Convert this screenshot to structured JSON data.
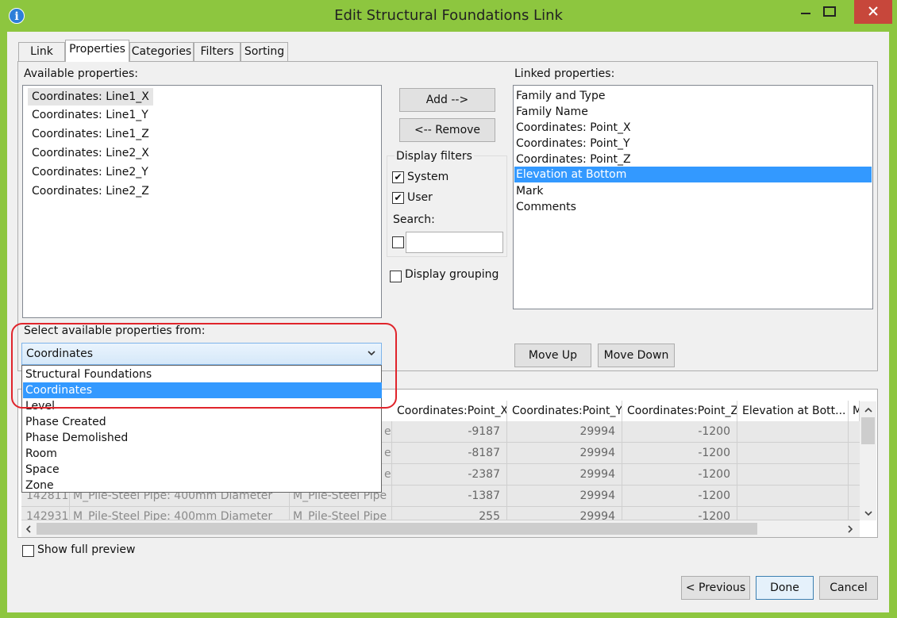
{
  "window": {
    "title": "Edit Structural Foundations Link",
    "app_icon": "info-icon",
    "minimize_icon": "minimize-icon",
    "maximize_icon": "maximize-icon",
    "close_icon": "close-icon",
    "title_bar_color": "#8dc63f",
    "close_color": "#c7473b"
  },
  "tabs": [
    {
      "label": "Link",
      "active": false
    },
    {
      "label": "Properties",
      "active": true
    },
    {
      "label": "Categories",
      "active": false
    },
    {
      "label": "Filters",
      "active": false
    },
    {
      "label": "Sorting",
      "active": false
    }
  ],
  "available": {
    "label": "Available properties:",
    "items": [
      "Coordinates: Line1_X",
      "Coordinates: Line1_Y",
      "Coordinates: Line1_Z",
      "Coordinates: Line2_X",
      "Coordinates: Line2_Y",
      "Coordinates: Line2_Z"
    ],
    "selected": "Coordinates: Line1_X"
  },
  "buttons": {
    "add": "Add -->",
    "remove": "<-- Remove",
    "move_up": "Move Up",
    "move_down": "Move Down",
    "previous": "< Previous",
    "done": "Done",
    "cancel": "Cancel"
  },
  "display_filters": {
    "label": "Display filters",
    "system": {
      "label": "System",
      "checked": true
    },
    "user": {
      "label": "User",
      "checked": true
    },
    "search_label": "Search:",
    "search_checkbox_checked": false,
    "search_value": ""
  },
  "display_grouping": {
    "label": "Display grouping",
    "checked": false
  },
  "linked": {
    "label": "Linked properties:",
    "items": [
      "Family and Type",
      "Family Name",
      "Coordinates: Point_X",
      "Coordinates: Point_Y",
      "Coordinates: Point_Z",
      "Elevation at Bottom",
      "Mark",
      "Comments"
    ],
    "selected": "Elevation at Bottom"
  },
  "select_from": {
    "label": "Select available properties from:",
    "value": "Coordinates",
    "options": [
      "Structural Foundations",
      "Coordinates",
      "Level",
      "Phase Created",
      "Phase Demolished",
      "Room",
      "Space",
      "Zone"
    ]
  },
  "preview": {
    "columns": [
      "Coordinates:Point_X",
      "Coordinates:Point_Y",
      "Coordinates:Point_Z",
      "Elevation at Bott...",
      "M"
    ],
    "rows": [
      {
        "id": "",
        "family": "",
        "type": "e",
        "x": "-9187",
        "y": "29994",
        "z": "-1200"
      },
      {
        "id": "",
        "family": "",
        "type": "e",
        "x": "-8187",
        "y": "29994",
        "z": "-1200"
      },
      {
        "id": "",
        "family": "",
        "type": "e",
        "x": "-2387",
        "y": "29994",
        "z": "-1200"
      },
      {
        "id": "142811",
        "family": "M_Pile-Steel Pipe: 400mm Diameter",
        "type": "M_Pile-Steel Pipe",
        "x": "-1387",
        "y": "29994",
        "z": "-1200"
      },
      {
        "id": "142931",
        "family": "M_Pile-Steel Pipe: 400mm Diameter",
        "type": "M_Pile-Steel Pipe",
        "x": "255",
        "y": "29994",
        "z": "-1200"
      }
    ]
  },
  "show_full_preview": {
    "label": "Show full preview",
    "checked": false
  },
  "accent": {
    "selection": "#3399ff",
    "callout": "#e0242b"
  }
}
